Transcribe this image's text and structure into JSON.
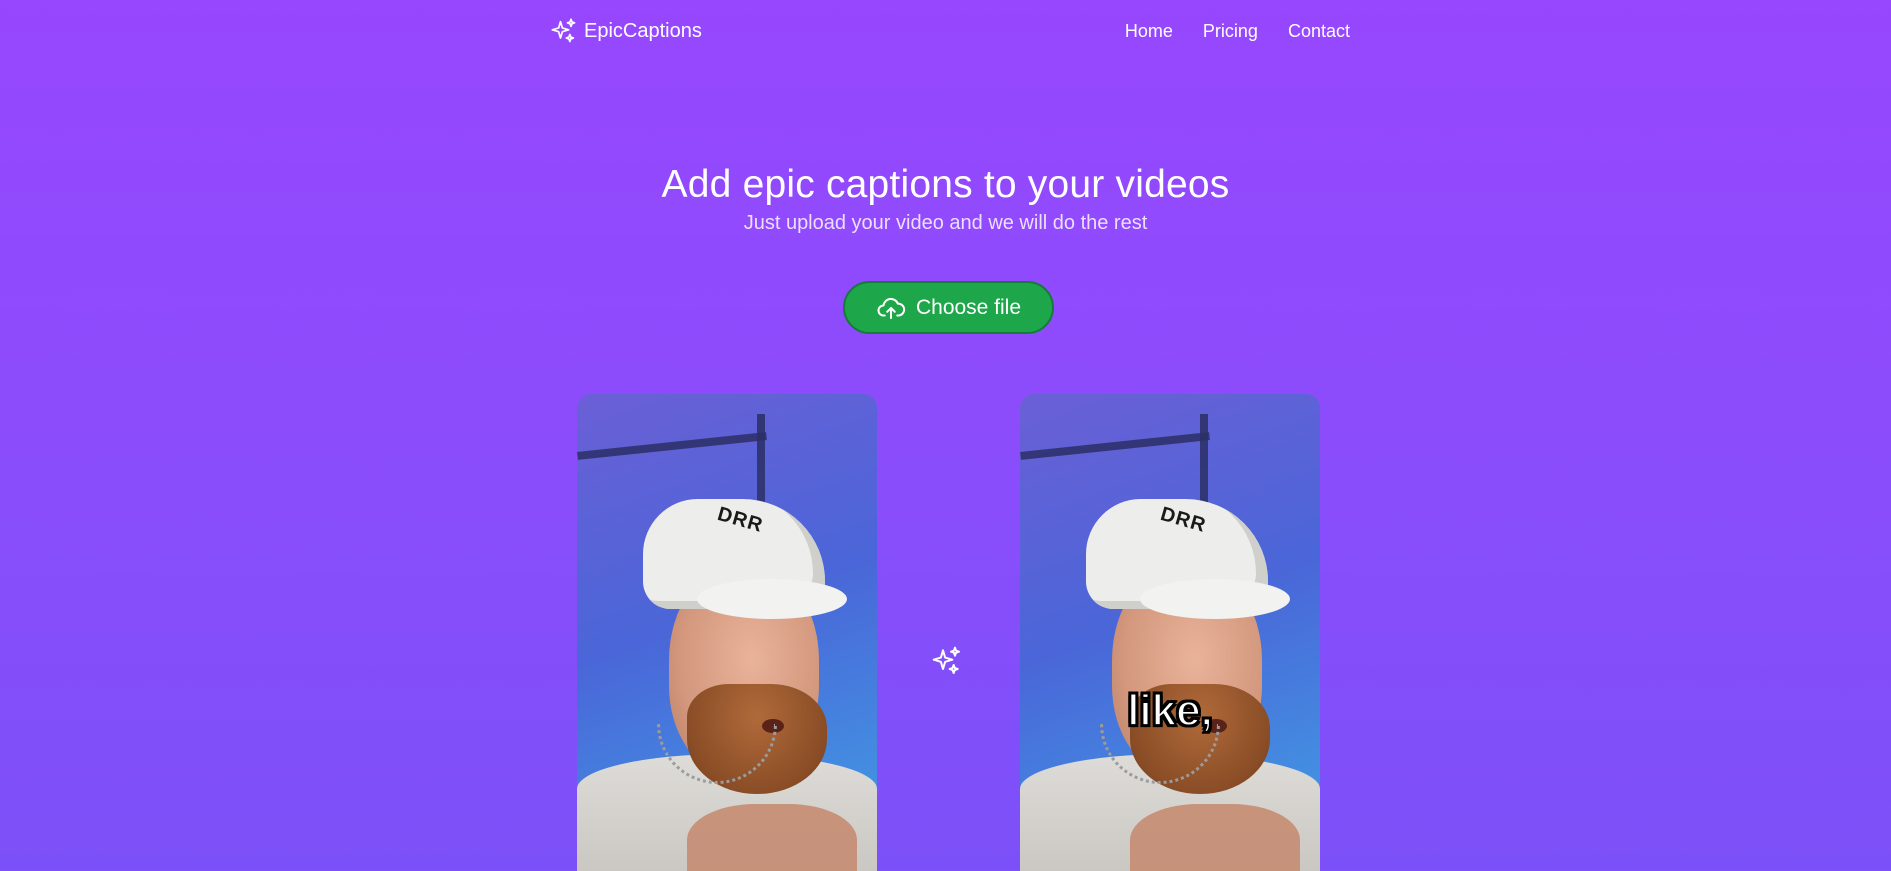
{
  "header": {
    "brand": "EpicCaptions",
    "nav": [
      {
        "label": "Home"
      },
      {
        "label": "Pricing"
      },
      {
        "label": "Contact"
      }
    ]
  },
  "hero": {
    "title": "Add epic captions to your videos",
    "subtitle": "Just upload your video and we will do the rest"
  },
  "upload": {
    "label": "Choose file",
    "icon": "cloud-upload-icon"
  },
  "demo": {
    "caption_word": "like,",
    "cap_print": "DRR",
    "arrow_icon": "sparkles-icon"
  },
  "colors": {
    "background": "#9747fe",
    "button": "#1ea64a",
    "text": "#ffffff"
  }
}
